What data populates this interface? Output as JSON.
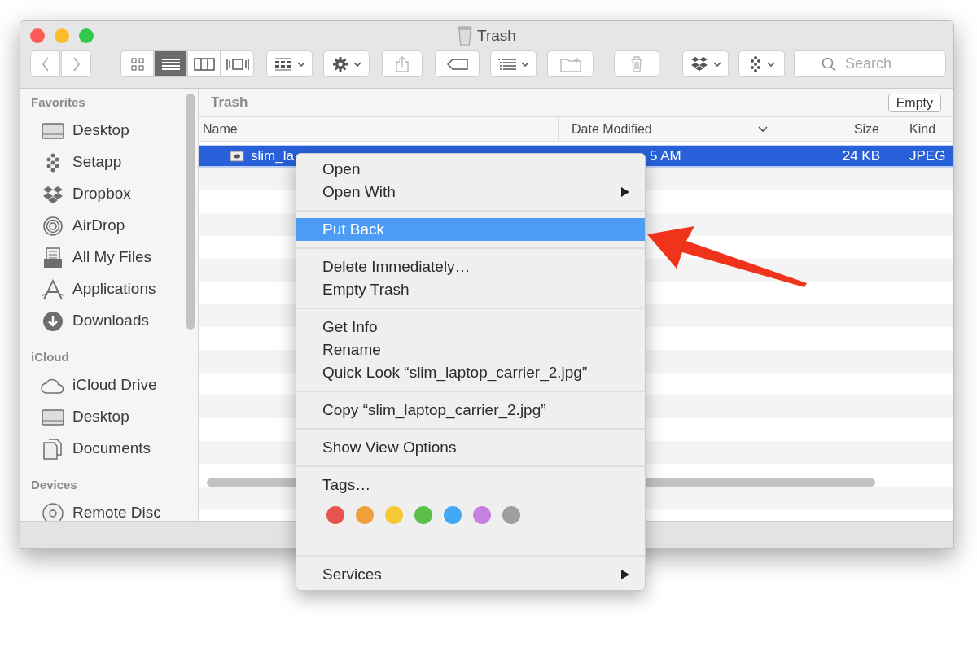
{
  "window": {
    "title": "Trash"
  },
  "toolbar": {
    "view_modes": [
      {
        "selected": false
      },
      {
        "selected": true
      },
      {
        "selected": false
      },
      {
        "selected": false
      }
    ],
    "search": {
      "placeholder": "Search"
    }
  },
  "sidebar": {
    "sections": [
      {
        "title": "Favorites",
        "items": [
          {
            "label": "Desktop"
          },
          {
            "label": "Setapp"
          },
          {
            "label": "Dropbox"
          },
          {
            "label": "AirDrop"
          },
          {
            "label": "All My Files"
          },
          {
            "label": "Applications"
          },
          {
            "label": "Downloads"
          }
        ]
      },
      {
        "title": "iCloud",
        "items": [
          {
            "label": "iCloud Drive"
          },
          {
            "label": "Desktop"
          },
          {
            "label": "Documents"
          }
        ]
      },
      {
        "title": "Devices",
        "items": [
          {
            "label": "Remote Disc"
          }
        ]
      }
    ]
  },
  "path_bar": {
    "title": "Trash",
    "button": "Empty"
  },
  "table": {
    "columns": [
      {
        "label": "Name",
        "sorted": false
      },
      {
        "label": "Date Modified",
        "sorted": true
      },
      {
        "label": "Size",
        "sorted": false
      },
      {
        "label": "Kind",
        "sorted": false
      }
    ],
    "rows": [
      {
        "name": "slim_la",
        "date_modified": "5 AM",
        "size": "24 KB",
        "kind": "JPEG",
        "selected": true
      }
    ]
  },
  "context_menu": {
    "groups": [
      {
        "items": [
          {
            "label": "Open",
            "has_submenu": false,
            "selected": false
          },
          {
            "label": "Open With",
            "has_submenu": true,
            "selected": false
          }
        ]
      },
      {
        "items": [
          {
            "label": "Put Back",
            "has_submenu": false,
            "selected": true
          }
        ]
      },
      {
        "items": [
          {
            "label": "Delete Immediately…",
            "has_submenu": false,
            "selected": false
          },
          {
            "label": "Empty Trash",
            "has_submenu": false,
            "selected": false
          }
        ]
      },
      {
        "items": [
          {
            "label": "Get Info",
            "has_submenu": false,
            "selected": false
          },
          {
            "label": "Rename",
            "has_submenu": false,
            "selected": false
          },
          {
            "label": "Quick Look “slim_laptop_carrier_2.jpg”",
            "has_submenu": false,
            "selected": false
          }
        ]
      },
      {
        "items": [
          {
            "label": "Copy “slim_laptop_carrier_2.jpg”",
            "has_submenu": false,
            "selected": false
          }
        ]
      },
      {
        "items": [
          {
            "label": "Show View Options",
            "has_submenu": false,
            "selected": false
          }
        ]
      },
      {
        "items": [
          {
            "label": "Tags…",
            "has_submenu": false,
            "selected": false
          }
        ],
        "tag_colors": [
          {
            "color": "#e9534f"
          },
          {
            "color": "#f0a03a"
          },
          {
            "color": "#f5c935"
          },
          {
            "color": "#5cbf4a"
          },
          {
            "color": "#3fa9f5"
          },
          {
            "color": "#c77fe0"
          },
          {
            "color": "#9e9e9e"
          }
        ]
      },
      {
        "items": [
          {
            "label": "Services",
            "has_submenu": true,
            "selected": false
          }
        ]
      }
    ]
  }
}
